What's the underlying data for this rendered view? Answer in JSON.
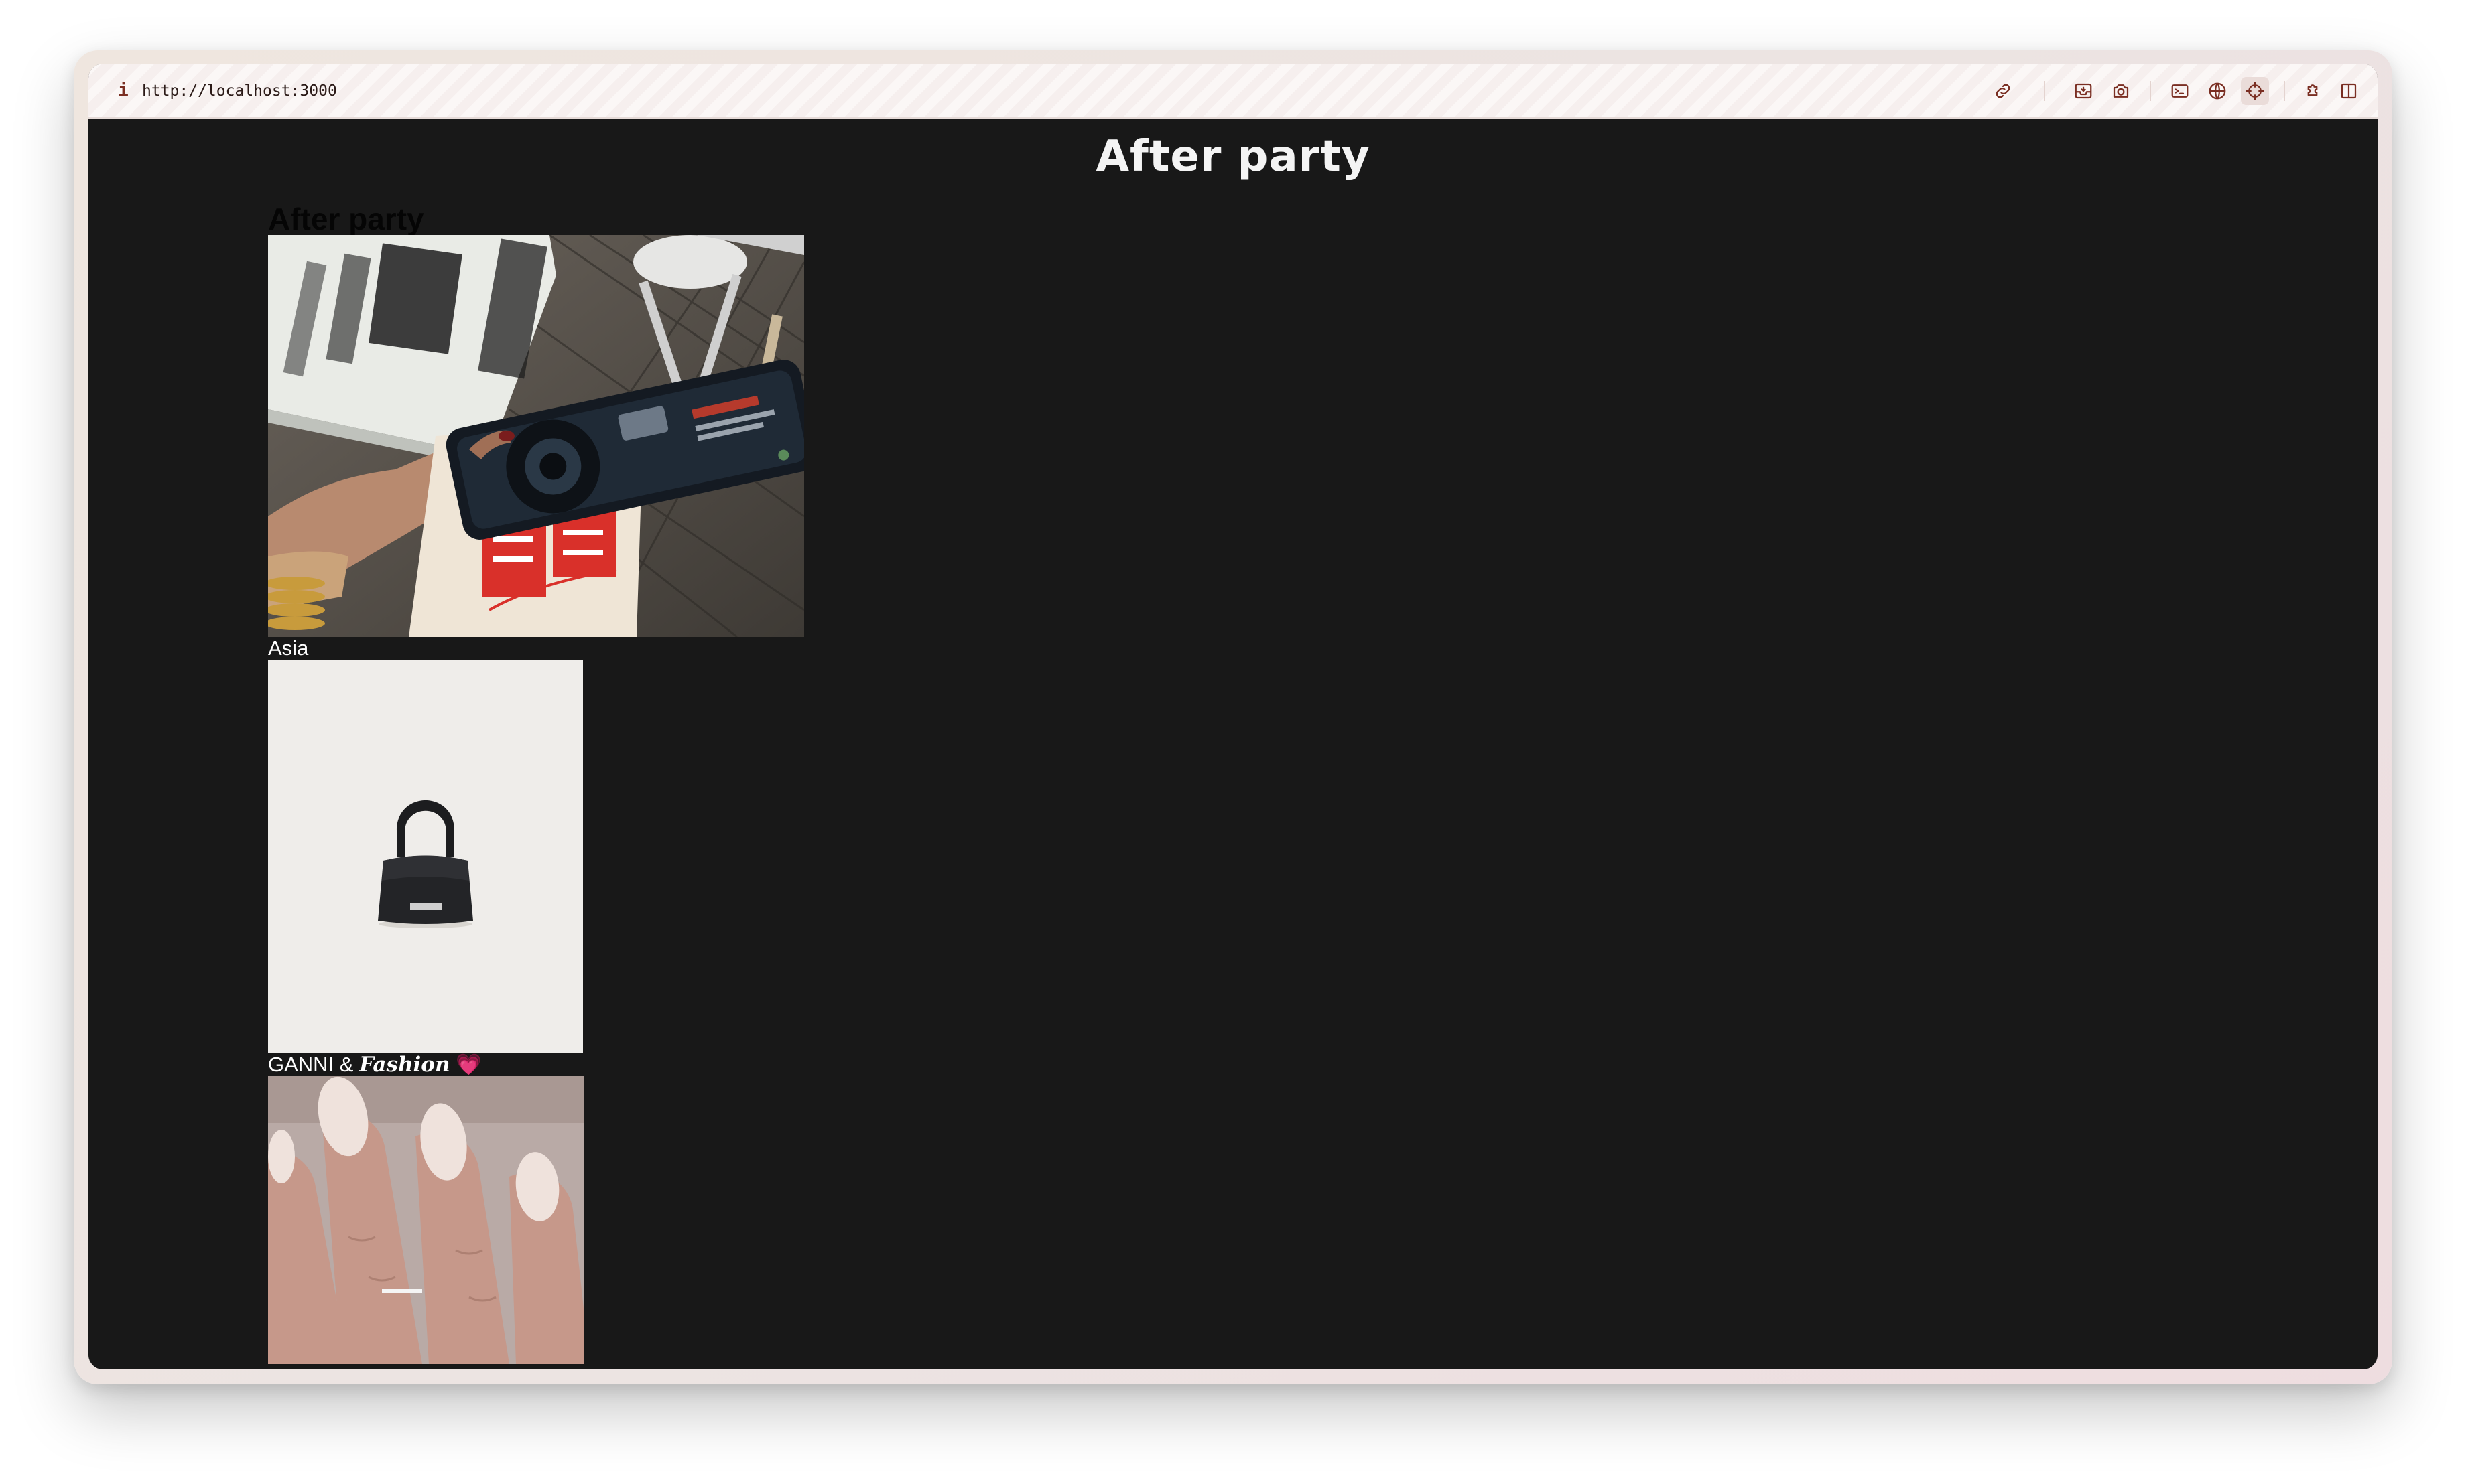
{
  "browser": {
    "url": "http://localhost:3000",
    "info_icon": "i",
    "toolbar_icons": [
      "link-icon",
      "inbox-icon",
      "camera-icon",
      "terminal-icon",
      "globe-icon",
      "crosshair-icon",
      "puzzle-icon",
      "sidebar-icon"
    ]
  },
  "page": {
    "brand_title": "After party",
    "section_heading": "After party",
    "posts": [
      {
        "caption": "Asia",
        "image": "photo-hand-holding-camera-tokyo-street"
      },
      {
        "caption_plain": "GANNI & ",
        "caption_fancy": "Fashion",
        "caption_emoji": "💗",
        "image": "photo-mini-black-handbag"
      },
      {
        "caption": "",
        "image": "photo-manicured-nails"
      }
    ]
  },
  "colors": {
    "page_bg": "#181818",
    "caption_text": "#ffffff",
    "heading_text": "#050505",
    "toolbar_icon": "#7a2e22"
  }
}
